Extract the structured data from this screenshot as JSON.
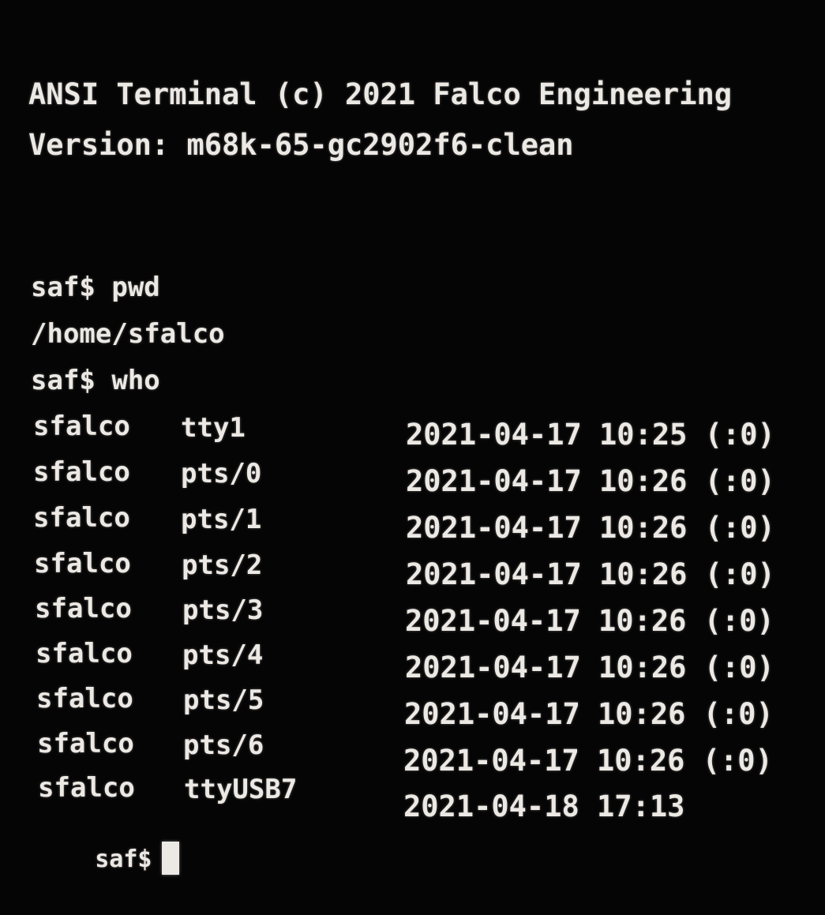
{
  "banner": {
    "title": "ANSI Terminal (c) 2021 Falco Engineering",
    "version": "Version: m68k-65-gc2902f6-clean"
  },
  "session": [
    {
      "type": "command",
      "text": "saf$ pwd"
    },
    {
      "type": "output",
      "text": "/home/sfalco"
    },
    {
      "type": "command",
      "text": "saf$ who"
    }
  ],
  "who_rows": [
    {
      "user": "sfalco",
      "tty": "tty1",
      "login": "2021-04-17 10:25 (:0)"
    },
    {
      "user": "sfalco",
      "tty": "pts/0",
      "login": "2021-04-17 10:26 (:0)"
    },
    {
      "user": "sfalco",
      "tty": "pts/1",
      "login": "2021-04-17 10:26 (:0)"
    },
    {
      "user": "sfalco",
      "tty": "pts/2",
      "login": "2021-04-17 10:26 (:0)"
    },
    {
      "user": "sfalco",
      "tty": "pts/3",
      "login": "2021-04-17 10:26 (:0)"
    },
    {
      "user": "sfalco",
      "tty": "pts/4",
      "login": "2021-04-17 10:26 (:0)"
    },
    {
      "user": "sfalco",
      "tty": "pts/5",
      "login": "2021-04-17 10:26 (:0)"
    },
    {
      "user": "sfalco",
      "tty": "pts/6",
      "login": "2021-04-17 10:26 (:0)"
    },
    {
      "user": "sfalco",
      "tty": "ttyUSB7",
      "login": "2021-04-18 17:13"
    }
  ],
  "prompt": "saf$"
}
